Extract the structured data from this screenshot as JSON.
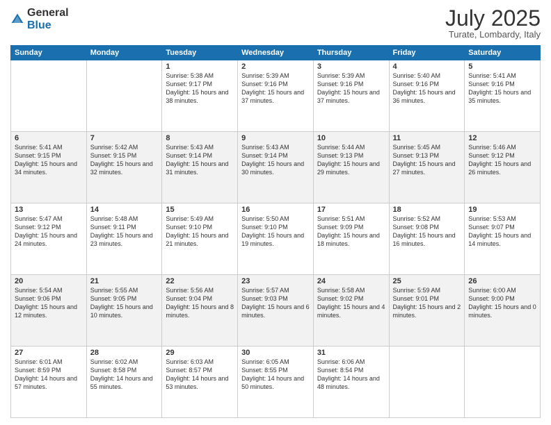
{
  "header": {
    "logo_general": "General",
    "logo_blue": "Blue",
    "month_title": "July 2025",
    "location": "Turate, Lombardy, Italy"
  },
  "days_of_week": [
    "Sunday",
    "Monday",
    "Tuesday",
    "Wednesday",
    "Thursday",
    "Friday",
    "Saturday"
  ],
  "weeks": [
    [
      {
        "day": "",
        "sunrise": "",
        "sunset": "",
        "daylight": ""
      },
      {
        "day": "",
        "sunrise": "",
        "sunset": "",
        "daylight": ""
      },
      {
        "day": "1",
        "sunrise": "Sunrise: 5:38 AM",
        "sunset": "Sunset: 9:17 PM",
        "daylight": "Daylight: 15 hours and 38 minutes."
      },
      {
        "day": "2",
        "sunrise": "Sunrise: 5:39 AM",
        "sunset": "Sunset: 9:16 PM",
        "daylight": "Daylight: 15 hours and 37 minutes."
      },
      {
        "day": "3",
        "sunrise": "Sunrise: 5:39 AM",
        "sunset": "Sunset: 9:16 PM",
        "daylight": "Daylight: 15 hours and 37 minutes."
      },
      {
        "day": "4",
        "sunrise": "Sunrise: 5:40 AM",
        "sunset": "Sunset: 9:16 PM",
        "daylight": "Daylight: 15 hours and 36 minutes."
      },
      {
        "day": "5",
        "sunrise": "Sunrise: 5:41 AM",
        "sunset": "Sunset: 9:16 PM",
        "daylight": "Daylight: 15 hours and 35 minutes."
      }
    ],
    [
      {
        "day": "6",
        "sunrise": "Sunrise: 5:41 AM",
        "sunset": "Sunset: 9:15 PM",
        "daylight": "Daylight: 15 hours and 34 minutes."
      },
      {
        "day": "7",
        "sunrise": "Sunrise: 5:42 AM",
        "sunset": "Sunset: 9:15 PM",
        "daylight": "Daylight: 15 hours and 32 minutes."
      },
      {
        "day": "8",
        "sunrise": "Sunrise: 5:43 AM",
        "sunset": "Sunset: 9:14 PM",
        "daylight": "Daylight: 15 hours and 31 minutes."
      },
      {
        "day": "9",
        "sunrise": "Sunrise: 5:43 AM",
        "sunset": "Sunset: 9:14 PM",
        "daylight": "Daylight: 15 hours and 30 minutes."
      },
      {
        "day": "10",
        "sunrise": "Sunrise: 5:44 AM",
        "sunset": "Sunset: 9:13 PM",
        "daylight": "Daylight: 15 hours and 29 minutes."
      },
      {
        "day": "11",
        "sunrise": "Sunrise: 5:45 AM",
        "sunset": "Sunset: 9:13 PM",
        "daylight": "Daylight: 15 hours and 27 minutes."
      },
      {
        "day": "12",
        "sunrise": "Sunrise: 5:46 AM",
        "sunset": "Sunset: 9:12 PM",
        "daylight": "Daylight: 15 hours and 26 minutes."
      }
    ],
    [
      {
        "day": "13",
        "sunrise": "Sunrise: 5:47 AM",
        "sunset": "Sunset: 9:12 PM",
        "daylight": "Daylight: 15 hours and 24 minutes."
      },
      {
        "day": "14",
        "sunrise": "Sunrise: 5:48 AM",
        "sunset": "Sunset: 9:11 PM",
        "daylight": "Daylight: 15 hours and 23 minutes."
      },
      {
        "day": "15",
        "sunrise": "Sunrise: 5:49 AM",
        "sunset": "Sunset: 9:10 PM",
        "daylight": "Daylight: 15 hours and 21 minutes."
      },
      {
        "day": "16",
        "sunrise": "Sunrise: 5:50 AM",
        "sunset": "Sunset: 9:10 PM",
        "daylight": "Daylight: 15 hours and 19 minutes."
      },
      {
        "day": "17",
        "sunrise": "Sunrise: 5:51 AM",
        "sunset": "Sunset: 9:09 PM",
        "daylight": "Daylight: 15 hours and 18 minutes."
      },
      {
        "day": "18",
        "sunrise": "Sunrise: 5:52 AM",
        "sunset": "Sunset: 9:08 PM",
        "daylight": "Daylight: 15 hours and 16 minutes."
      },
      {
        "day": "19",
        "sunrise": "Sunrise: 5:53 AM",
        "sunset": "Sunset: 9:07 PM",
        "daylight": "Daylight: 15 hours and 14 minutes."
      }
    ],
    [
      {
        "day": "20",
        "sunrise": "Sunrise: 5:54 AM",
        "sunset": "Sunset: 9:06 PM",
        "daylight": "Daylight: 15 hours and 12 minutes."
      },
      {
        "day": "21",
        "sunrise": "Sunrise: 5:55 AM",
        "sunset": "Sunset: 9:05 PM",
        "daylight": "Daylight: 15 hours and 10 minutes."
      },
      {
        "day": "22",
        "sunrise": "Sunrise: 5:56 AM",
        "sunset": "Sunset: 9:04 PM",
        "daylight": "Daylight: 15 hours and 8 minutes."
      },
      {
        "day": "23",
        "sunrise": "Sunrise: 5:57 AM",
        "sunset": "Sunset: 9:03 PM",
        "daylight": "Daylight: 15 hours and 6 minutes."
      },
      {
        "day": "24",
        "sunrise": "Sunrise: 5:58 AM",
        "sunset": "Sunset: 9:02 PM",
        "daylight": "Daylight: 15 hours and 4 minutes."
      },
      {
        "day": "25",
        "sunrise": "Sunrise: 5:59 AM",
        "sunset": "Sunset: 9:01 PM",
        "daylight": "Daylight: 15 hours and 2 minutes."
      },
      {
        "day": "26",
        "sunrise": "Sunrise: 6:00 AM",
        "sunset": "Sunset: 9:00 PM",
        "daylight": "Daylight: 15 hours and 0 minutes."
      }
    ],
    [
      {
        "day": "27",
        "sunrise": "Sunrise: 6:01 AM",
        "sunset": "Sunset: 8:59 PM",
        "daylight": "Daylight: 14 hours and 57 minutes."
      },
      {
        "day": "28",
        "sunrise": "Sunrise: 6:02 AM",
        "sunset": "Sunset: 8:58 PM",
        "daylight": "Daylight: 14 hours and 55 minutes."
      },
      {
        "day": "29",
        "sunrise": "Sunrise: 6:03 AM",
        "sunset": "Sunset: 8:57 PM",
        "daylight": "Daylight: 14 hours and 53 minutes."
      },
      {
        "day": "30",
        "sunrise": "Sunrise: 6:05 AM",
        "sunset": "Sunset: 8:55 PM",
        "daylight": "Daylight: 14 hours and 50 minutes."
      },
      {
        "day": "31",
        "sunrise": "Sunrise: 6:06 AM",
        "sunset": "Sunset: 8:54 PM",
        "daylight": "Daylight: 14 hours and 48 minutes."
      },
      {
        "day": "",
        "sunrise": "",
        "sunset": "",
        "daylight": ""
      },
      {
        "day": "",
        "sunrise": "",
        "sunset": "",
        "daylight": ""
      }
    ]
  ]
}
